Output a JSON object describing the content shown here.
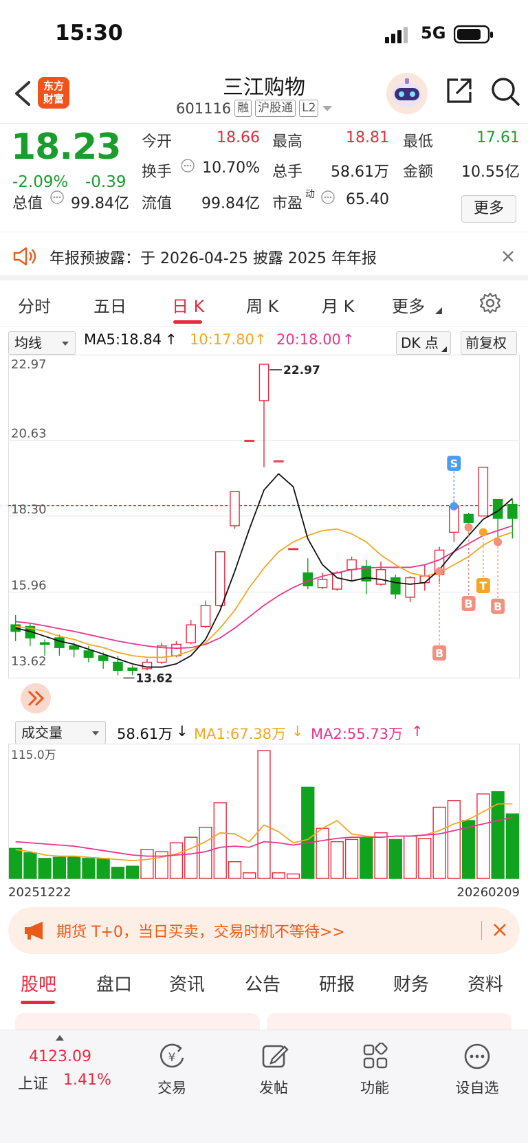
{
  "status": {
    "time": "15:30",
    "network": "5G"
  },
  "header": {
    "logo_line1": "东方",
    "logo_line2": "财富",
    "title": "三江购物",
    "code": "601116",
    "tag_margin": "融",
    "tag_connect": "沪股通",
    "tag_level": "L2"
  },
  "quote": {
    "price": "18.23",
    "change_pct": "-2.09%",
    "change_amt": "-0.39",
    "open_label": "今开",
    "open": "18.66",
    "high_label": "最高",
    "high": "18.81",
    "low_label": "最低",
    "low": "17.61",
    "turnover_label": "换手",
    "turnover": "10.70%",
    "volume_label": "总手",
    "volume": "58.61万",
    "amount_label": "金额",
    "amount": "10.55亿",
    "mktcap_label": "总值",
    "mktcap": "99.84亿",
    "float_label": "流值",
    "float": "99.84亿",
    "pe_label": "市盈",
    "pe_sup": "动",
    "pe": "65.40",
    "more_label": "更多"
  },
  "notice": {
    "text": "年报预披露：于 2026-04-25 披露 2025 年年报"
  },
  "period_tabs": [
    "分时",
    "五日",
    "日 K",
    "周 K",
    "月 K",
    "更多"
  ],
  "indicator": {
    "ma_select": "均线",
    "ma5": "MA5:18.84",
    "ma10": "10:17.80",
    "ma20": "20:18.00",
    "dk": "DK 点",
    "adjust": "前复权"
  },
  "volume_indicator": {
    "select": "成交量",
    "vol": "58.61万",
    "ma1": "MA1:67.38万",
    "ma2": "MA2:55.73万"
  },
  "colors": {
    "up": "#e8293d",
    "down": "#0fa31e",
    "ma5": "#111111",
    "ma10": "#f5a623",
    "ma20": "#e6358e",
    "accent": "#f0521c"
  },
  "chart_data": {
    "type": "candlestick",
    "y_axis_labels": [
      "22.97",
      "20.63",
      "18.30",
      "15.96",
      "13.62"
    ],
    "ylim": [
      13.62,
      22.97
    ],
    "max_label": "22.97",
    "min_label": "13.62",
    "volume_axis_label": "115.0万",
    "volume_max": 115.0,
    "x_start": "20251222",
    "x_end": "20260209",
    "signals": [
      "S",
      "B",
      "B",
      "B",
      "T"
    ],
    "candles": [
      {
        "o": 14.95,
        "c": 14.75,
        "h": 15.25,
        "l": 14.45
      },
      {
        "o": 14.9,
        "c": 14.55,
        "h": 15.0,
        "l": 14.3
      },
      {
        "o": 14.4,
        "c": 14.35,
        "h": 14.5,
        "l": 14.0
      },
      {
        "o": 14.55,
        "c": 14.25,
        "h": 14.65,
        "l": 14.0
      },
      {
        "o": 14.3,
        "c": 14.2,
        "h": 14.4,
        "l": 13.95
      },
      {
        "o": 14.15,
        "c": 13.95,
        "h": 14.3,
        "l": 13.8
      },
      {
        "o": 14.0,
        "c": 13.85,
        "h": 14.1,
        "l": 13.6
      },
      {
        "o": 13.8,
        "c": 13.55,
        "h": 14.0,
        "l": 13.4
      },
      {
        "o": 13.62,
        "c": 13.55,
        "h": 13.7,
        "l": 13.4
      },
      {
        "o": 13.6,
        "c": 13.8,
        "h": 13.9,
        "l": 13.55
      },
      {
        "o": 13.8,
        "c": 14.3,
        "h": 14.4,
        "l": 13.75
      },
      {
        "o": 14.0,
        "c": 14.35,
        "h": 14.45,
        "l": 13.95
      },
      {
        "o": 14.4,
        "c": 14.95,
        "h": 15.1,
        "l": 14.35
      },
      {
        "o": 14.9,
        "c": 15.55,
        "h": 15.7,
        "l": 14.85
      },
      {
        "o": 15.55,
        "c": 17.2,
        "h": 17.2,
        "l": 15.5
      },
      {
        "o": 18.0,
        "c": 19.05,
        "h": 19.05,
        "l": 17.9
      },
      {
        "o": 20.63,
        "c": 20.63,
        "h": 20.63,
        "l": 20.63
      },
      {
        "o": 21.85,
        "c": 22.97,
        "h": 22.97,
        "l": 19.8
      },
      {
        "o": 20.0,
        "c": 20.0,
        "h": 20.0,
        "l": 20.0
      },
      {
        "o": 17.3,
        "c": 17.3,
        "h": 17.3,
        "l": 17.3
      },
      {
        "o": 16.55,
        "c": 16.15,
        "h": 17.0,
        "l": 16.05
      },
      {
        "o": 16.1,
        "c": 16.35,
        "h": 16.55,
        "l": 16.05
      },
      {
        "o": 16.05,
        "c": 16.55,
        "h": 16.6,
        "l": 16.0
      },
      {
        "o": 16.65,
        "c": 16.95,
        "h": 17.05,
        "l": 16.3
      },
      {
        "o": 16.75,
        "c": 16.3,
        "h": 16.95,
        "l": 15.9
      },
      {
        "o": 16.2,
        "c": 16.65,
        "h": 16.9,
        "l": 16.15
      },
      {
        "o": 16.4,
        "c": 15.9,
        "h": 16.5,
        "l": 15.75
      },
      {
        "o": 15.8,
        "c": 16.4,
        "h": 16.45,
        "l": 15.65
      },
      {
        "o": 16.25,
        "c": 16.45,
        "h": 16.8,
        "l": 16.0
      },
      {
        "o": 16.5,
        "c": 17.25,
        "h": 17.35,
        "l": 16.2
      },
      {
        "o": 17.8,
        "c": 18.6,
        "h": 18.8,
        "l": 17.5
      },
      {
        "o": 18.35,
        "c": 18.1,
        "h": 18.4,
        "l": 17.75
      },
      {
        "o": 18.3,
        "c": 19.8,
        "h": 19.8,
        "l": 18.3
      },
      {
        "o": 18.81,
        "c": 18.23,
        "h": 18.81,
        "l": 17.61
      },
      {
        "o": 18.66,
        "c": 18.23,
        "h": 18.81,
        "l": 17.61
      }
    ],
    "volumes": [
      27,
      23,
      18,
      19,
      19,
      18,
      18,
      10,
      11,
      26,
      24,
      32,
      37,
      46,
      68,
      15,
      5,
      115,
      5,
      4,
      82,
      45,
      33,
      35,
      37,
      41,
      35,
      38,
      36,
      64,
      70,
      52,
      76,
      78,
      58
    ],
    "ma5": [
      14.85,
      14.75,
      14.6,
      14.45,
      14.35,
      14.2,
      14.05,
      13.9,
      13.75,
      13.65,
      13.65,
      13.75,
      14.0,
      14.5,
      15.4,
      16.6,
      17.9,
      19.1,
      19.6,
      19.2,
      17.6,
      16.8,
      16.4,
      16.3,
      16.4,
      16.35,
      16.25,
      16.2,
      16.25,
      16.65,
      17.2,
      17.7,
      18.2,
      18.45,
      18.84
    ],
    "ma10": [
      14.9,
      14.85,
      14.75,
      14.6,
      14.5,
      14.35,
      14.25,
      14.1,
      14.0,
      13.95,
      13.95,
      14.0,
      14.15,
      14.4,
      14.85,
      15.4,
      16.1,
      16.7,
      17.2,
      17.5,
      17.7,
      17.85,
      17.9,
      17.75,
      17.5,
      17.1,
      16.8,
      16.55,
      16.45,
      16.55,
      16.8,
      17.05,
      17.4,
      17.65,
      17.8
    ],
    "ma20": [
      15.05,
      15.0,
      14.92,
      14.83,
      14.75,
      14.65,
      14.55,
      14.45,
      14.37,
      14.3,
      14.25,
      14.23,
      14.25,
      14.35,
      14.55,
      14.85,
      15.2,
      15.55,
      15.85,
      16.1,
      16.3,
      16.45,
      16.55,
      16.65,
      16.7,
      16.72,
      16.72,
      16.72,
      16.8,
      16.95,
      17.2,
      17.45,
      17.7,
      17.85,
      18.0
    ],
    "vol_ma1": [
      26,
      24,
      21,
      20,
      20,
      19,
      18,
      17,
      16,
      17,
      19,
      22,
      27,
      33,
      41,
      40,
      33,
      48,
      42,
      32,
      35,
      45,
      52,
      40,
      38,
      37,
      38,
      38,
      39,
      43,
      49,
      53,
      60,
      67,
      67
    ],
    "vol_ma2": [
      33,
      32,
      31,
      30,
      29,
      27,
      25,
      23,
      21,
      20,
      20,
      21,
      22,
      24,
      28,
      29,
      28,
      33,
      32,
      30,
      32,
      34,
      36,
      37,
      37,
      37,
      38,
      38,
      39,
      40,
      43,
      46,
      49,
      52,
      55
    ]
  },
  "ad": {
    "text": "期货 T+0，当日买卖，交易时机不等待>>"
  },
  "bottom_tabs": [
    "股吧",
    "盘口",
    "资讯",
    "公告",
    "研报",
    "财务",
    "资料"
  ],
  "bottom_nav": {
    "index_value": "4123.09",
    "index_name": "上证",
    "index_pct": "1.41%",
    "trade": "交易",
    "post": "发帖",
    "functions": "功能",
    "watchlist": "设自选"
  }
}
